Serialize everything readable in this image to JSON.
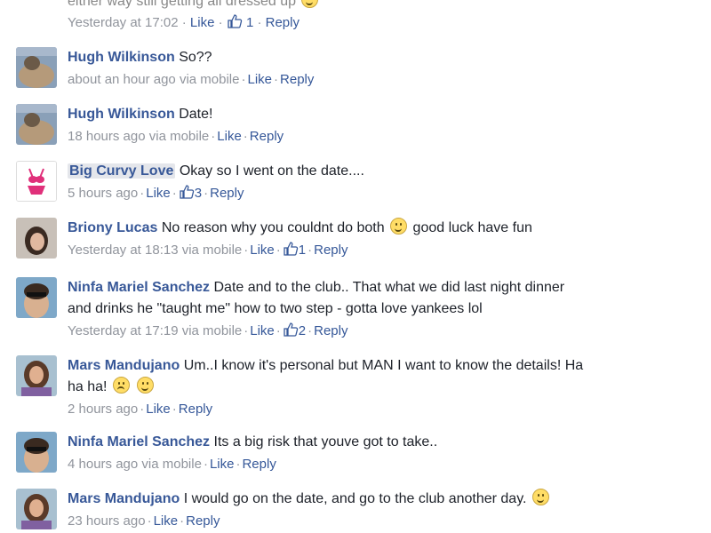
{
  "top": {
    "text_partial": "either way still getting all dressed up",
    "time": "Yesterday at 17:02",
    "like": "Like",
    "likes": "1",
    "reply": "Reply"
  },
  "comments": [
    {
      "name": "Hugh Wilkinson",
      "text": "So??",
      "time": "about an hour ago via mobile",
      "like": "Like",
      "reply": "Reply",
      "likes": "",
      "avatar": "avatar-hugh"
    },
    {
      "name": "Hugh Wilkinson",
      "text": "Date!",
      "time": "18 hours ago via mobile",
      "like": "Like",
      "reply": "Reply",
      "likes": "",
      "avatar": "avatar-hugh"
    },
    {
      "name": "Big Curvy Love",
      "text": "Okay so I went on the date....",
      "time": "5 hours ago",
      "like": "Like",
      "reply": "Reply",
      "likes": "3",
      "avatar": "avatar-swimsuit"
    },
    {
      "name": "Briony Lucas",
      "text": "No reason why you couldnt do both",
      "text_after": "good luck have fun",
      "time": "Yesterday at 18:13 via mobile",
      "like": "Like",
      "reply": "Reply",
      "likes": "1",
      "avatar": "avatar-briony"
    },
    {
      "name": "Ninfa Mariel Sanchez",
      "text": "Date and to the club.. That what we did last night dinner",
      "text2": "and drinks he \"taught me\" how to two step - gotta love yankees lol",
      "time": "Yesterday at 17:19 via mobile",
      "like": "Like",
      "reply": "Reply",
      "likes": "2",
      "avatar": "avatar-ninfa"
    },
    {
      "name": "Mars Mandujano",
      "text": "Um..I know it's personal but MAN I want to know the details! Ha",
      "text2": "ha ha!",
      "time": "2 hours ago",
      "like": "Like",
      "reply": "Reply",
      "likes": "",
      "avatar": "avatar-mars"
    },
    {
      "name": "Ninfa Mariel Sanchez",
      "text": "Its a big risk that youve got to take..",
      "time": "4 hours ago via mobile",
      "like": "Like",
      "reply": "Reply",
      "likes": "",
      "avatar": "avatar-ninfa"
    },
    {
      "name": "Mars Mandujano",
      "text": "I would go on the date, and go to the club another day.",
      "time": "23 hours ago",
      "like": "Like",
      "reply": "Reply",
      "likes": "",
      "avatar": "avatar-mars"
    }
  ]
}
